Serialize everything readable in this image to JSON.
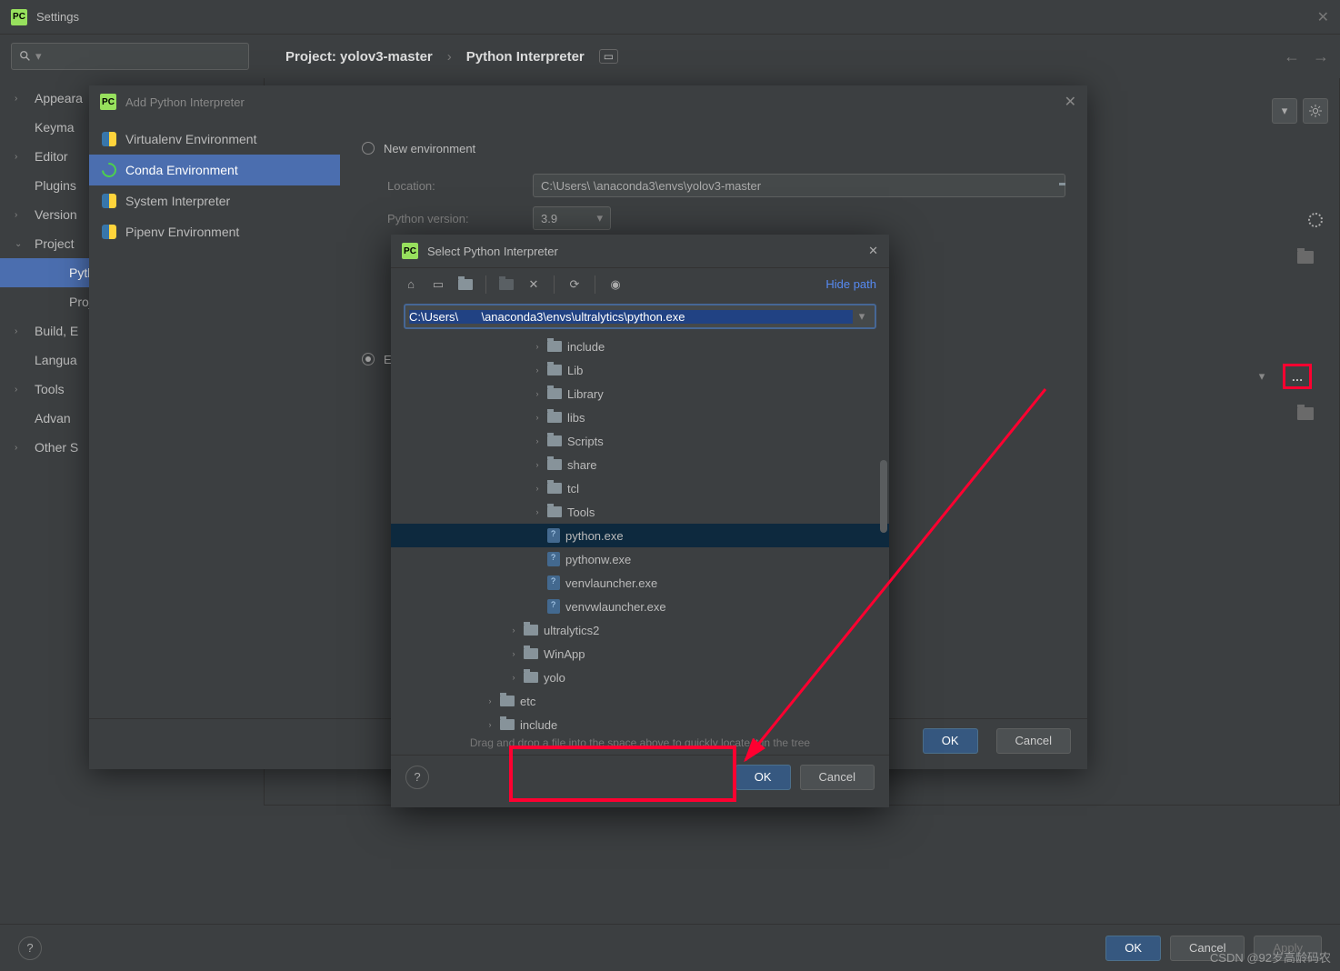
{
  "window": {
    "title": "Settings"
  },
  "breadcrumb": {
    "project_prefix": "Project:",
    "project": "yolov3-master",
    "page": "Python Interpreter"
  },
  "sidebar": {
    "items": [
      {
        "label": "Appeara",
        "exp": "›"
      },
      {
        "label": "Keyma",
        "exp": ""
      },
      {
        "label": "Editor",
        "exp": "›"
      },
      {
        "label": "Plugins",
        "exp": ""
      },
      {
        "label": "Version",
        "exp": "›"
      },
      {
        "label": "Project",
        "exp": "⌄"
      },
      {
        "label": "Pyth",
        "exp": "",
        "sub": true,
        "sel": true
      },
      {
        "label": "Proje",
        "exp": "",
        "sub": true
      },
      {
        "label": "Build, E",
        "exp": "›"
      },
      {
        "label": "Langua",
        "exp": ""
      },
      {
        "label": "Tools",
        "exp": "›"
      },
      {
        "label": "Advan",
        "exp": ""
      },
      {
        "label": "Other S",
        "exp": "›"
      }
    ]
  },
  "addInterp": {
    "title": "Add Python Interpreter",
    "envs": [
      {
        "label": "Virtualenv Environment",
        "icon": "py"
      },
      {
        "label": "Conda Environment",
        "icon": "conda",
        "sel": true
      },
      {
        "label": "System Interpreter",
        "icon": "py"
      },
      {
        "label": "Pipenv Environment",
        "icon": "py"
      }
    ],
    "newEnv": "New environment",
    "existingEnv": "E",
    "fields": {
      "location_label": "Location:",
      "location_value": "C:\\Users\\        \\anaconda3\\envs\\yolov3-master",
      "pyver_label": "Python version:",
      "pyver_value": "3.9"
    },
    "ok": "OK",
    "cancel": "Cancel"
  },
  "selectInterp": {
    "title": "Select Python Interpreter",
    "hidePath": "Hide path",
    "path": "C:\\Users\\       \\anaconda3\\envs\\ultralytics\\python.exe",
    "tree": [
      {
        "label": "include",
        "type": "fld",
        "indent": 6,
        "exp": "›"
      },
      {
        "label": "Lib",
        "type": "fld",
        "indent": 6,
        "exp": "›"
      },
      {
        "label": "Library",
        "type": "fld",
        "indent": 6,
        "exp": "›"
      },
      {
        "label": "libs",
        "type": "fld",
        "indent": 6,
        "exp": "›"
      },
      {
        "label": "Scripts",
        "type": "fld",
        "indent": 6,
        "exp": "›"
      },
      {
        "label": "share",
        "type": "fld",
        "indent": 6,
        "exp": "›"
      },
      {
        "label": "tcl",
        "type": "fld",
        "indent": 6,
        "exp": "›"
      },
      {
        "label": "Tools",
        "type": "fld",
        "indent": 6,
        "exp": "›"
      },
      {
        "label": "python.exe",
        "type": "exe",
        "indent": 6,
        "sel": true
      },
      {
        "label": "pythonw.exe",
        "type": "exe",
        "indent": 6
      },
      {
        "label": "venvlauncher.exe",
        "type": "exe",
        "indent": 6
      },
      {
        "label": "venvwlauncher.exe",
        "type": "exe",
        "indent": 6
      },
      {
        "label": "ultralytics2",
        "type": "fld",
        "indent": 5,
        "exp": "›"
      },
      {
        "label": "WinApp",
        "type": "fld",
        "indent": 5,
        "exp": "›"
      },
      {
        "label": "yolo",
        "type": "fld",
        "indent": 5,
        "exp": "›"
      },
      {
        "label": "etc",
        "type": "fld",
        "indent": 4,
        "exp": "›"
      },
      {
        "label": "include",
        "type": "fld",
        "indent": 4,
        "exp": "›"
      }
    ],
    "hint": "Drag and drop a file into the space above to quickly locate it in the tree",
    "ok": "OK",
    "cancel": "Cancel"
  },
  "footer": {
    "ok": "OK",
    "cancel": "Cancel",
    "apply": "Apply"
  },
  "watermark": "CSDN @92岁高龄码农"
}
